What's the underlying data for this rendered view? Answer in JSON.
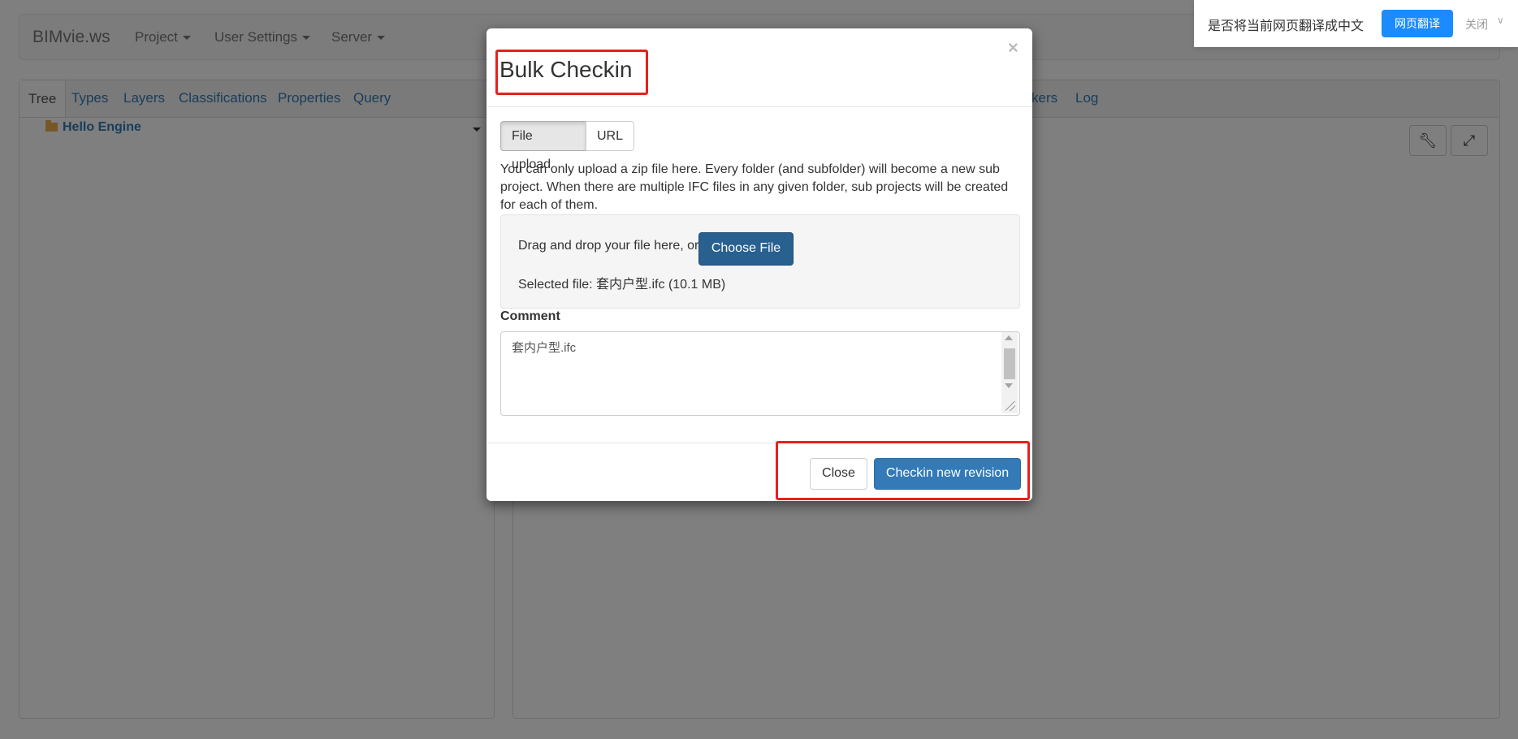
{
  "app": {
    "brand": "BIMvie.ws",
    "nav": [
      "Project",
      "User Settings",
      "Server"
    ]
  },
  "left_panel": {
    "tabs": [
      "Tree",
      "Types",
      "Layers",
      "Classifications",
      "Properties",
      "Query"
    ],
    "active_tab": "Tree",
    "tree_root": "Hello Engine"
  },
  "right_panel": {
    "tabs_visible": [
      "kers",
      "Log"
    ],
    "tool_icons": [
      "wrench-icon",
      "expand-icon"
    ]
  },
  "translate_bar": {
    "prompt": "是否将当前网页翻译成中文",
    "translate_button": "网页翻译",
    "close": "关闭"
  },
  "modal": {
    "title": "Bulk Checkin",
    "close_symbol": "×",
    "source_options": [
      "File upload",
      "URL"
    ],
    "selected_source": "File upload",
    "help_text": "You can only upload a zip file here. Every folder (and subfolder) will become a new sub project. When there are multiple IFC files in any given folder, sub projects will be created for each of them.",
    "drop_text": "Drag and drop your file here, or",
    "choose_file_label": "Choose File",
    "selected_file_text": "Selected file: 套内户型.ifc (10.1 MB)",
    "comment_label": "Comment",
    "comment_value": "套内户型.ifc",
    "close_label": "Close",
    "submit_label": "Checkin new revision"
  },
  "colors": {
    "primary": "#337ab7",
    "primary_dark": "#286090",
    "highlight": "#e8201b",
    "translate_blue": "#1a8cff"
  }
}
